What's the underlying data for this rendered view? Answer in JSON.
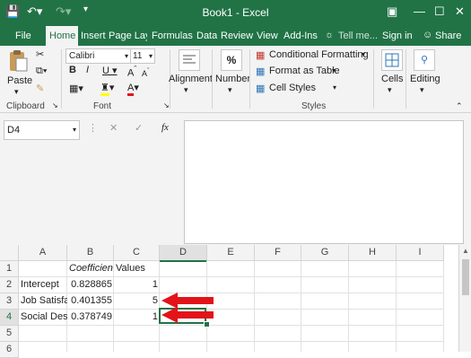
{
  "window": {
    "title": "Book1 - Excel"
  },
  "ribbon_tabs": [
    "File",
    "Home",
    "Insert",
    "Page Layo",
    "Formulas",
    "Data",
    "Review",
    "View",
    "Add-Ins"
  ],
  "tell_me": "Tell me...",
  "sign_in": "Sign in",
  "share": "Share",
  "clipboard": {
    "paste": "Paste",
    "group": "Clipboard"
  },
  "font": {
    "name": "Calibri",
    "size": "11",
    "group": "Font"
  },
  "alignment": {
    "label": "Alignment"
  },
  "number": {
    "label": "Number",
    "symbol": "%"
  },
  "styles": {
    "conditional": "Conditional Formatting",
    "format_table": "Format as Table",
    "cell_styles": "Cell Styles",
    "group": "Styles"
  },
  "cells": {
    "label": "Cells"
  },
  "editing": {
    "label": "Editing"
  },
  "name_box": "D4",
  "fx": "fx",
  "columns": [
    "A",
    "B",
    "C",
    "D",
    "E",
    "F",
    "G",
    "H",
    "I"
  ],
  "rows": [
    "1",
    "2",
    "3",
    "4",
    "5",
    "6"
  ],
  "cells_data": {
    "B1": "Coefficien",
    "C1": "Values",
    "A2": "Intercept",
    "B2": "0.828865",
    "C2": "1",
    "A3": "Job Satisfa",
    "B3": "0.401355",
    "C3": "5",
    "A4": "Social Des",
    "B4": "0.378749",
    "C4": "1"
  },
  "colors": {
    "excel_green": "#217346",
    "arrow_red": "#e3131a",
    "selection": "#217346"
  }
}
